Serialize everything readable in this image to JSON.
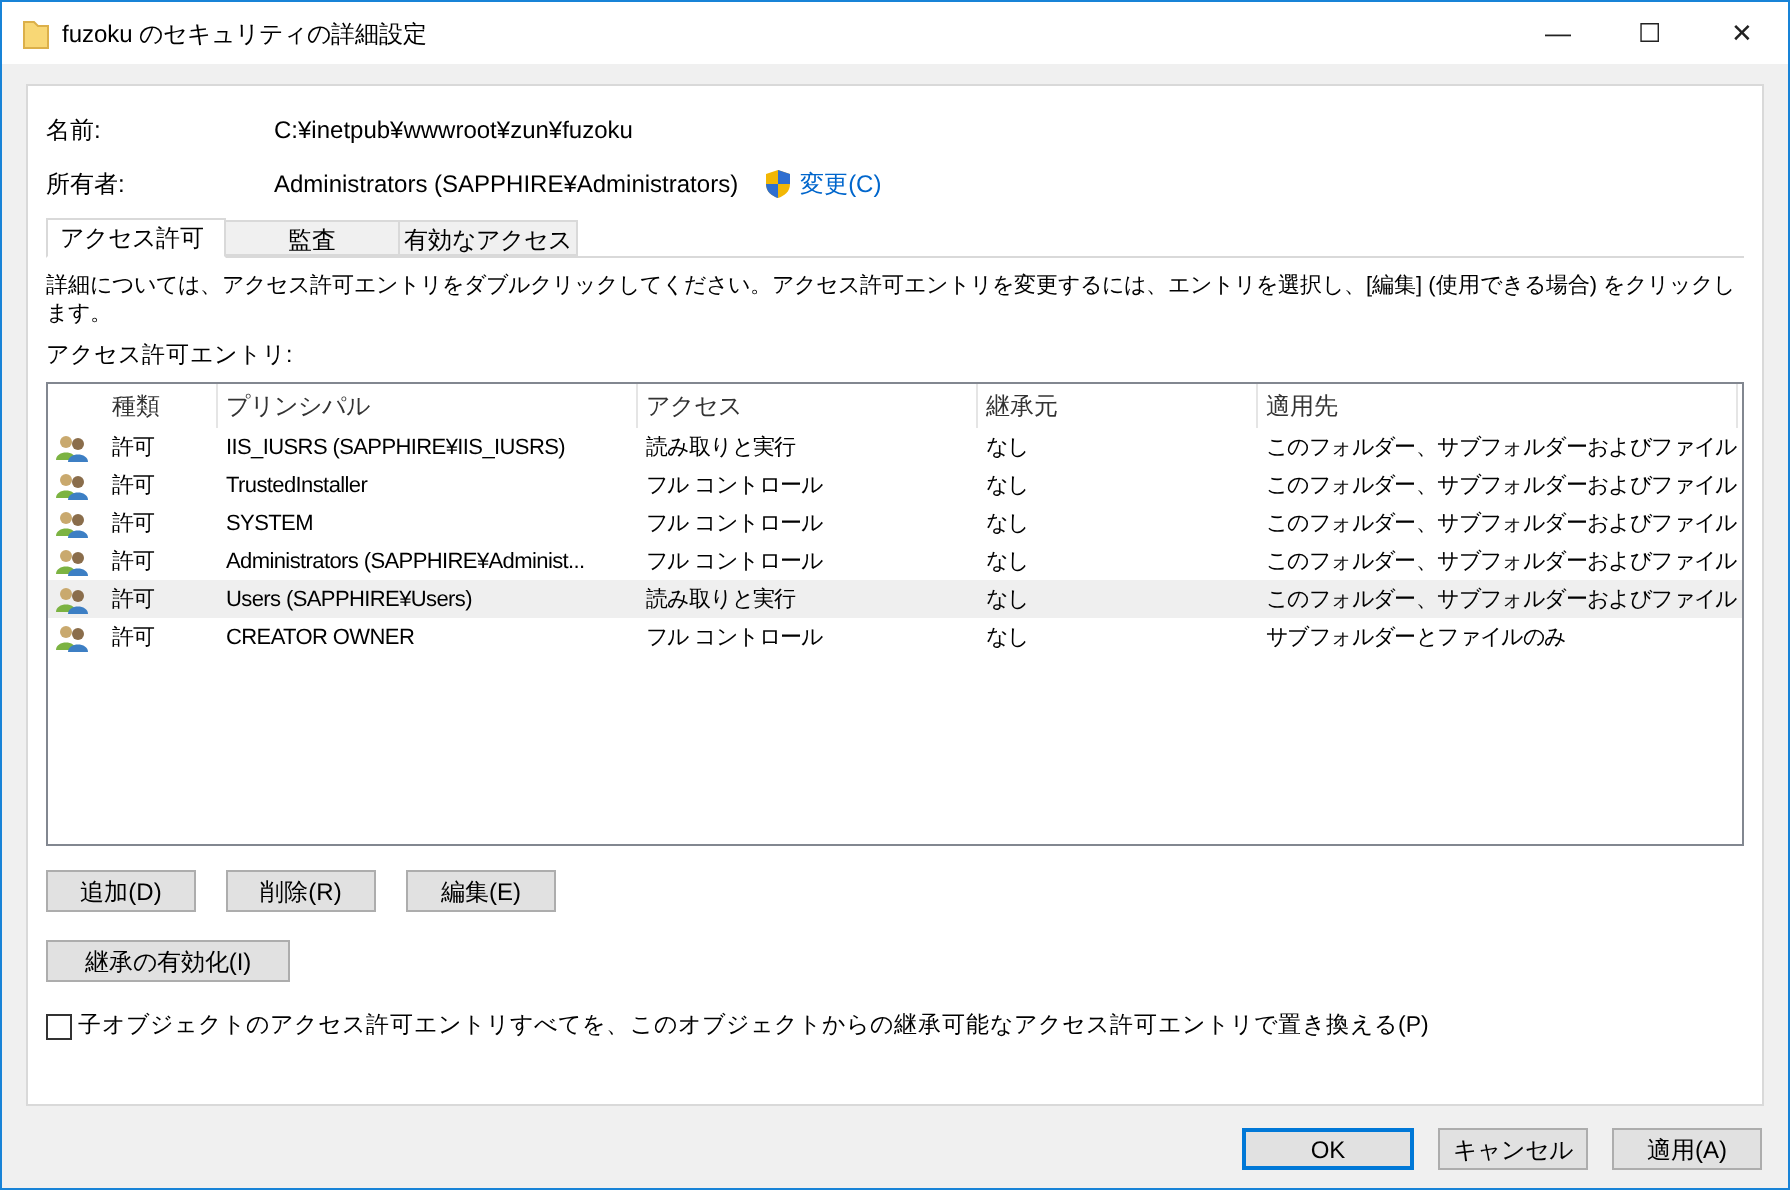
{
  "window": {
    "title": "fuzoku のセキュリティの詳細設定",
    "controls": [
      "—",
      "☐",
      "✕"
    ]
  },
  "fields": [
    {
      "label": "名前:",
      "value": "C:¥inetpub¥wwwroot¥zun¥fuzoku"
    },
    {
      "label": "所有者:",
      "value": "Administrators (SAPPHIRE¥Administrators)",
      "link": "変更(C)"
    }
  ],
  "tabs": [
    {
      "label": "アクセス許可",
      "selected": true
    },
    {
      "label": "監査",
      "selected": false
    },
    {
      "label": "有効なアクセス",
      "selected": false
    }
  ],
  "instructions": "詳細については、アクセス許可エントリをダブルクリックしてください。アクセス許可エントリを変更するには、エントリを選択し、[編集] (使用できる場合) をクリックします。",
  "list_label": "アクセス許可エントリ:",
  "table": {
    "columns": [
      "種類",
      "プリンシパル",
      "アクセス",
      "継承元",
      "適用先"
    ],
    "rows": [
      {
        "cells": [
          "許可",
          "IIS_IUSRS (SAPPHIRE¥IIS_IUSRS)",
          "読み取りと実行",
          "なし",
          "このフォルダー、サブフォルダーおよびファイル"
        ],
        "selected": false
      },
      {
        "cells": [
          "許可",
          "TrustedInstaller",
          "フル コントロール",
          "なし",
          "このフォルダー、サブフォルダーおよびファイル"
        ],
        "selected": false
      },
      {
        "cells": [
          "許可",
          "SYSTEM",
          "フル コントロール",
          "なし",
          "このフォルダー、サブフォルダーおよびファイル"
        ],
        "selected": false
      },
      {
        "cells": [
          "許可",
          "Administrators (SAPPHIRE¥Administ...",
          "フル コントロール",
          "なし",
          "このフォルダー、サブフォルダーおよびファイル"
        ],
        "selected": false
      },
      {
        "cells": [
          "許可",
          "Users (SAPPHIRE¥Users)",
          "読み取りと実行",
          "なし",
          "このフォルダー、サブフォルダーおよびファイル"
        ],
        "selected": true
      },
      {
        "cells": [
          "許可",
          "CREATOR OWNER",
          "フル コントロール",
          "なし",
          "サブフォルダーとファイルのみ"
        ],
        "selected": false
      }
    ]
  },
  "entry_buttons": [
    "追加(D)",
    "削除(R)",
    "編集(E)"
  ],
  "inherit_button": "継承の有効化(I)",
  "replace_checkbox": {
    "label": "子オブジェクトのアクセス許可エントリすべてを、このオブジェクトからの継承可能なアクセス許可エントリで置き換える(P)",
    "checked": false
  },
  "dialog_buttons": [
    {
      "label": "OK",
      "default": true
    },
    {
      "label": "キャンセル",
      "default": false
    },
    {
      "label": "適用(A)",
      "default": false
    }
  ]
}
